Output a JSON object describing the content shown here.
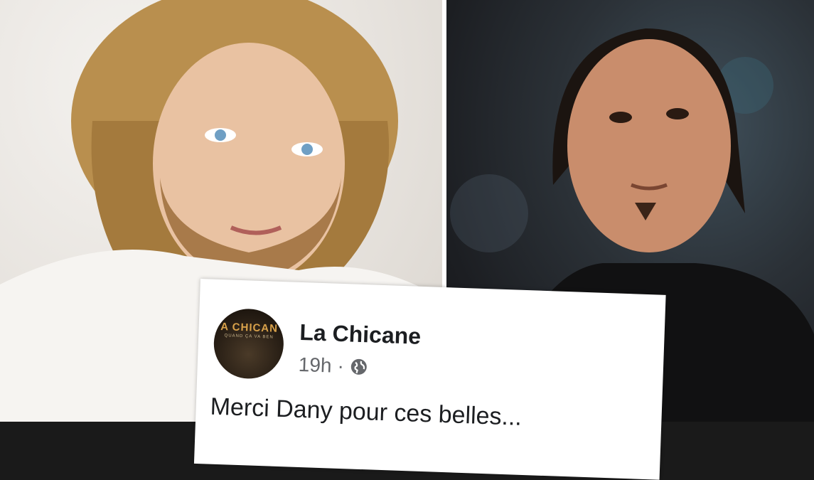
{
  "post": {
    "page_name": "La Chicane",
    "avatar_text": "A CHICAN",
    "avatar_subtext": "QUAND ÇA VA BEN",
    "time": "19h",
    "separator": "·",
    "audience_icon": "globe-icon",
    "text": "Merci Dany pour ces belles..."
  }
}
